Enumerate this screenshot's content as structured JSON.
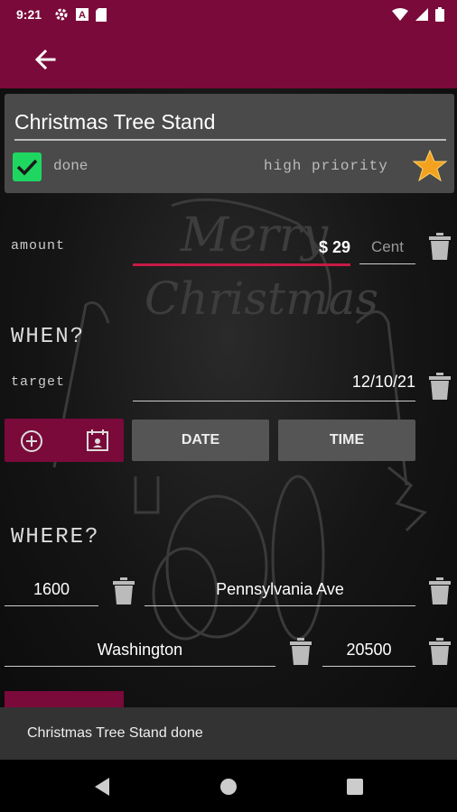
{
  "status_bar": {
    "time": "9:21",
    "left_icons": [
      "gear-icon",
      "a-icon",
      "sdcard-icon"
    ],
    "right_icons": [
      "wifi-icon",
      "signal-icon",
      "battery-icon"
    ]
  },
  "app_bar": {
    "back_icon": "arrow-left-icon",
    "color": "#7a0a3a"
  },
  "item": {
    "title": "Christmas Tree Stand",
    "done_label": "done",
    "done_checked": true,
    "priority_label": "high priority",
    "priority_icon": "star-icon"
  },
  "amount": {
    "label": "amount",
    "value": "$ 29",
    "cent_placeholder": "Cent"
  },
  "when": {
    "title": "WHEN?",
    "target_label": "target",
    "target_value": "12/10/21",
    "date_button": "DATE",
    "time_button": "TIME"
  },
  "where": {
    "title": "WHERE?",
    "number": "1600",
    "street": "Pennsylvania Ave",
    "city": "Washington",
    "zip": "20500"
  },
  "snackbar": {
    "text": "Christmas Tree Stand done"
  },
  "colors": {
    "accent": "#7a0a3a",
    "check": "#1fd760",
    "underline_active": "#c81a45"
  }
}
